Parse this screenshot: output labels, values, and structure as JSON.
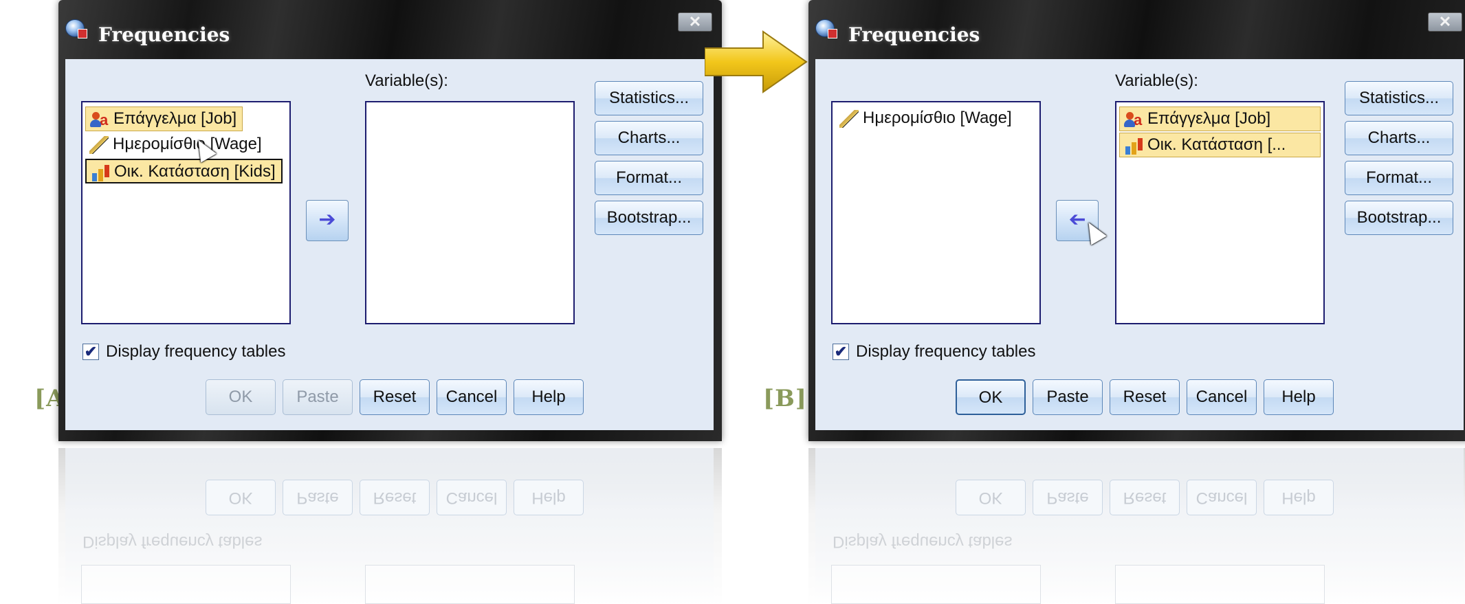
{
  "panels": {
    "a": {
      "tag": "[A]",
      "title": "Frequencies",
      "close": "✕",
      "variables_label": "Variable(s):",
      "source_items": [
        "Επάγγελμα [Job]",
        "Ημερομίσθιο [Wage]",
        "Οικ. Κατάσταση [Kids]"
      ],
      "move_arrow": "➔",
      "side_buttons": [
        "Statistics...",
        "Charts...",
        "Format...",
        "Bootstrap..."
      ],
      "checkbox_label": "Display frequency tables",
      "checkbox_mark": "✔",
      "bottom_buttons": [
        "OK",
        "Paste",
        "Reset",
        "Cancel",
        "Help"
      ]
    },
    "b": {
      "tag": "[B]",
      "title": "Frequencies",
      "close": "✕",
      "variables_label": "Variable(s):",
      "source_items": [
        "Ημερομίσθιο [Wage]"
      ],
      "target_items": [
        "Επάγγελμα [Job]",
        "Οικ. Κατάσταση [..."
      ],
      "move_arrow": "➔",
      "side_buttons": [
        "Statistics...",
        "Charts...",
        "Format...",
        "Bootstrap..."
      ],
      "checkbox_label": "Display frequency tables",
      "checkbox_mark": "✔",
      "bottom_buttons": [
        "OK",
        "Paste",
        "Reset",
        "Cancel",
        "Help"
      ]
    }
  },
  "reflection": {
    "text": "Display frequency tables",
    "buttons": [
      "OK",
      "Paste",
      "Reset",
      "Cancel",
      "Help"
    ]
  },
  "colors": {
    "selection": "#fbe7a3",
    "client_bg": "#e2eaf5",
    "list_border": "#1c1c6e",
    "tag_color": "#8a9a5b",
    "arrow_yellow": "#f2c71b"
  },
  "icons": {
    "nominal": "nominal-variable-icon",
    "scale": "scale-variable-icon",
    "ordinal": "ordinal-variable-icon"
  }
}
